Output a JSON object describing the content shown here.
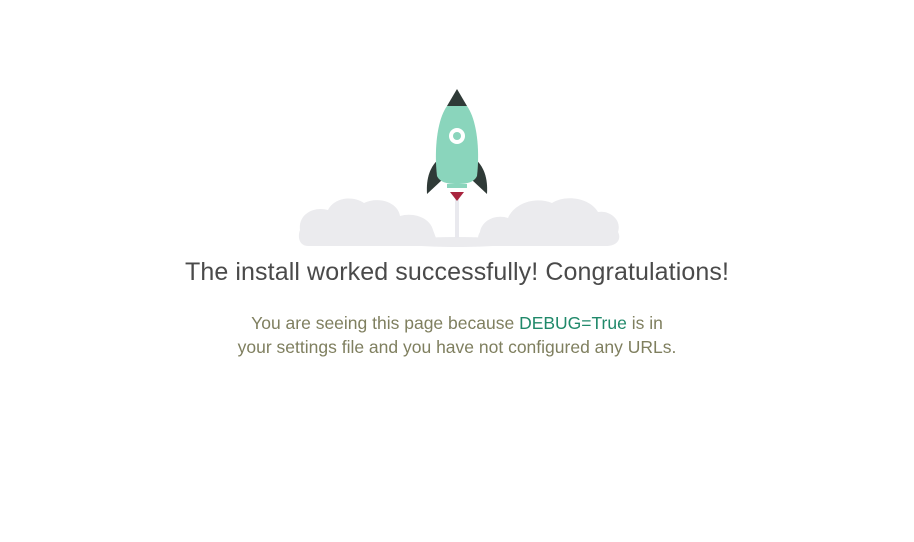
{
  "heading": "The install worked successfully! Congratulations!",
  "message": {
    "before": "You are seeing this page because ",
    "debug_setting": "DEBUG=True",
    "after": " is in your settings file and you have not configured any URLs."
  },
  "illustration": {
    "icon": "rocket-icon",
    "clouds": "cloud-icon",
    "colors": {
      "rocket_body": "#8ad5bc",
      "rocket_dark": "#2f3a37",
      "flame": "#a9243e",
      "cloud": "#ebebee"
    }
  },
  "colors": {
    "heading": "#4a4a4a",
    "text": "#7f7f5f",
    "link": "#20896a"
  }
}
